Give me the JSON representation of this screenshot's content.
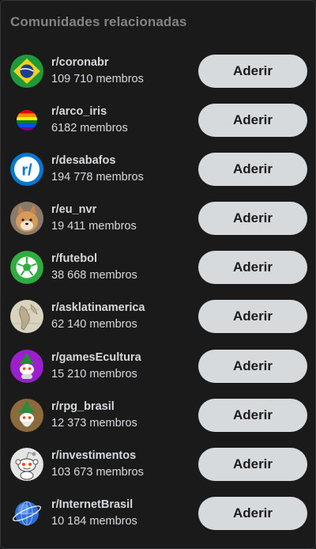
{
  "widget": {
    "title": "Comunidades relacionadas"
  },
  "communities": [
    {
      "name": "r/coronabr",
      "members": "109 710 membros",
      "button": "Aderir",
      "icon": "brazil-flag-icon"
    },
    {
      "name": "r/arco_iris",
      "members": "6182 membros",
      "button": "Aderir",
      "icon": "rainbow-flag-icon"
    },
    {
      "name": "r/desabafos",
      "members": "194 778 membros",
      "button": "Aderir",
      "icon": "reddit-r-icon"
    },
    {
      "name": "r/eu_nvr",
      "members": "19 411 membros",
      "button": "Aderir",
      "icon": "shiba-dog-icon"
    },
    {
      "name": "r/futebol",
      "members": "38 668 membros",
      "button": "Aderir",
      "icon": "soccer-ball-icon"
    },
    {
      "name": "r/asklatinamerica",
      "members": "62 140 membros",
      "button": "Aderir",
      "icon": "old-map-icon"
    },
    {
      "name": "r/gamesEcultura",
      "members": "15 210 membros",
      "button": "Aderir",
      "icon": "snoo-witch-icon"
    },
    {
      "name": "r/rpg_brasil",
      "members": "12 373 membros",
      "button": "Aderir",
      "icon": "snoo-wizard-icon"
    },
    {
      "name": "r/investimentos",
      "members": "103 673 membros",
      "button": "Aderir",
      "icon": "snoo-icon"
    },
    {
      "name": "r/InternetBrasil",
      "members": "10 184 membros",
      "button": "Aderir",
      "icon": "globe-icon"
    }
  ],
  "colors": {
    "background": "#1a1a1b",
    "title": "#818384",
    "text": "#d7dadc",
    "button_bg": "#d7dadc",
    "button_text": "#1a1a1b"
  }
}
